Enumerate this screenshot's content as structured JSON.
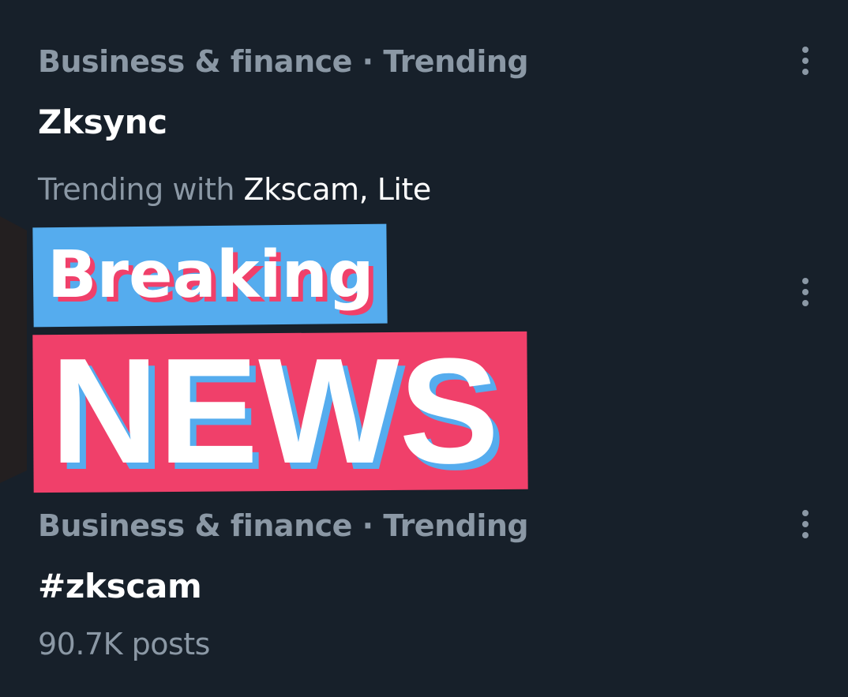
{
  "trends": [
    {
      "category": "Business & finance · Trending",
      "title": "Zksync",
      "sub_prefix": "Trending with ",
      "sub_highlight": "Zkscam, Lite",
      "more_icon": "more-vertical-icon"
    },
    {
      "category": "Business & finance · Trending",
      "title": "#zkscam",
      "sub": "90.7K posts",
      "more_icon": "more-vertical-icon"
    }
  ],
  "middle_more_icon": "more-vertical-icon",
  "news_graphic": {
    "line1": "Breaking",
    "line2": "NEWS",
    "colors": {
      "blue": "#55acee",
      "pink": "#f0406a",
      "white": "#ffffff",
      "dark_tab": "#231f20"
    }
  },
  "colors": {
    "background": "#17202a",
    "secondary_text": "#8b98a5",
    "primary_text": "#ffffff"
  }
}
